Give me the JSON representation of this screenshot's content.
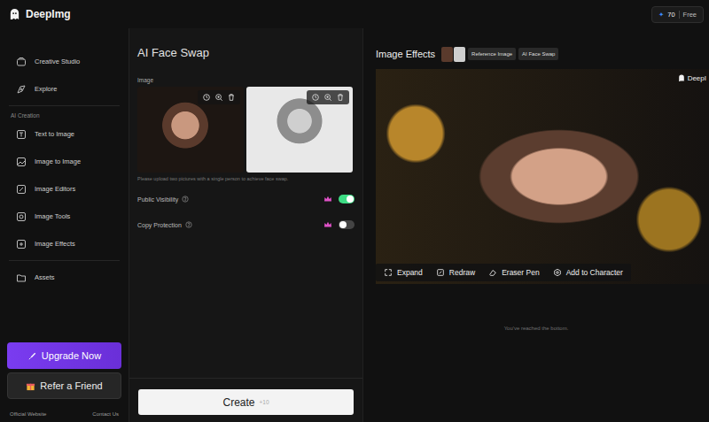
{
  "app": {
    "name": "DeepImg"
  },
  "credits": {
    "icon": "✦",
    "count": "70",
    "plan": "Free"
  },
  "sidebar": {
    "top_items": [
      {
        "label": "Creative Studio",
        "selected": false
      },
      {
        "label": "Explore",
        "selected": false
      }
    ],
    "section": "AI Creation",
    "creation_items": [
      {
        "label": "Text to Image",
        "selected": false
      },
      {
        "label": "Image to Image",
        "selected": false
      },
      {
        "label": "Image Editors",
        "selected": false
      },
      {
        "label": "Image Tools",
        "selected": false
      },
      {
        "label": "Image Effects",
        "selected": false
      }
    ],
    "bottom_items": [
      {
        "label": "Assets",
        "selected": false
      }
    ],
    "upgrade": "Upgrade Now",
    "refer": "Refer a Friend",
    "footer": [
      "Official Website",
      "Contact Us"
    ]
  },
  "face_swap": {
    "title": "AI Face Swap",
    "image_label": "Image",
    "images": [
      {
        "grayscale": false
      },
      {
        "grayscale": true
      }
    ],
    "hint": "Please upload two pictures with a single person to achieve face swap.",
    "toggles": [
      {
        "label": "Public Visibility",
        "on": true
      },
      {
        "label": "Copy Protection",
        "on": false
      }
    ],
    "create": {
      "label": "Create",
      "cost": "+10"
    }
  },
  "result": {
    "title": "Image Effects",
    "tags": [
      "Reference Image",
      "AI Face Swap"
    ],
    "watermark": "DeepI",
    "actions": [
      "Expand",
      "Redraw",
      "Eraser Pen",
      "Add to Character"
    ],
    "end_note": "You've reached the bottom."
  }
}
